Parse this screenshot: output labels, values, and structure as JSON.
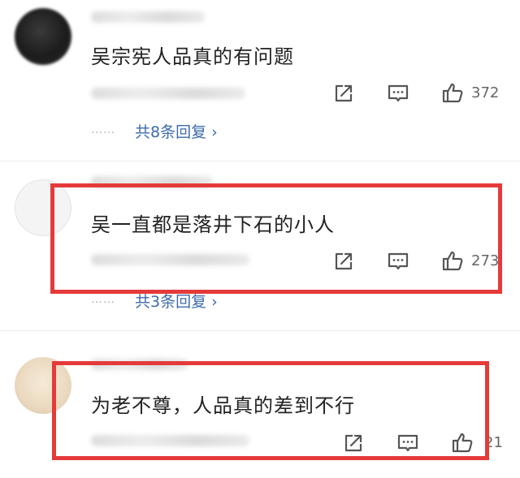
{
  "comments": [
    {
      "text": "吴宗宪人品真的有问题",
      "like_count": "372",
      "replies_label": "共8条回复 ›",
      "dots": "……"
    },
    {
      "text": "吴一直都是落井下石的小人",
      "like_count": "273",
      "replies_label": "共3条回复 ›",
      "dots": "……"
    },
    {
      "text": "为老不尊，人品真的差到不行",
      "like_count": "21"
    }
  ],
  "colors": {
    "highlight": "#e53a3a",
    "reply_link": "#3d6bab"
  },
  "icons": [
    "share-icon",
    "comment-icon",
    "thumbs-up-icon"
  ]
}
